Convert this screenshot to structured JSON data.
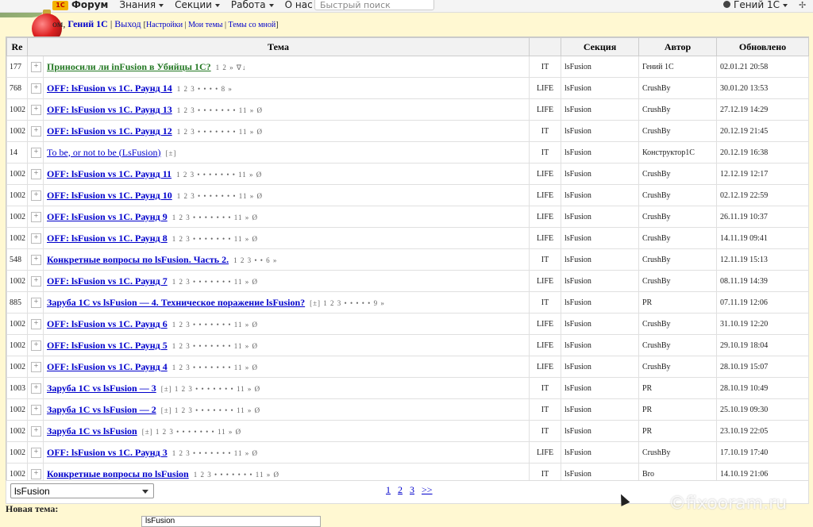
{
  "topbar": {
    "nav": [
      "Форум",
      "Знания",
      "Секции",
      "Работа",
      "О нас"
    ],
    "search_placeholder": "Быстрый поиск",
    "user": "Гений 1С"
  },
  "greeting": {
    "prefix": "ом,",
    "user": "Гений 1С",
    "logout": "Выход",
    "settings": "Настройки",
    "my_topics": "Мои темы",
    "topics_with_me": "Темы со мной"
  },
  "table": {
    "headers": {
      "replies": "Re",
      "title": "Тема",
      "section": "Секция",
      "author": "Автор",
      "updated": "Обновлено"
    },
    "rows": [
      {
        "re": "177",
        "title": "Приносили ли inFusion в Убийцы 1С?",
        "pages": "1 2 » ∇↓",
        "sec": "IT",
        "section": "lsFusion",
        "author": "Гений 1С",
        "updated": "02.01.21 20:58"
      },
      {
        "re": "768",
        "title": "OFF: lsFusion vs 1C. Раунд 14",
        "pages": "1 2 3 • • • • 8 »",
        "sec": "LIFE",
        "section": "lsFusion",
        "author": "CrushBy",
        "updated": "30.01.20 13:53"
      },
      {
        "re": "1002",
        "title": "OFF: lsFusion vs 1C. Раунд 13",
        "pages": "1 2 3 • • • • • • • 11 » Ø",
        "sec": "LIFE",
        "section": "lsFusion",
        "author": "CrushBy",
        "updated": "27.12.19 14:29"
      },
      {
        "re": "1002",
        "title": "OFF: lsFusion vs 1C. Раунд 12",
        "pages": "1 2 3 • • • • • • • 11 » Ø",
        "sec": "IT",
        "section": "lsFusion",
        "author": "CrushBy",
        "updated": "20.12.19 21:45"
      },
      {
        "re": "14",
        "title": "To be, or not to be (LsFusion)",
        "pages": "[±]",
        "sec": "IT",
        "section": "lsFusion",
        "author": "Конструктор1С",
        "updated": "20.12.19 16:38"
      },
      {
        "re": "1002",
        "title": "OFF: lsFusion vs 1C. Раунд 11",
        "pages": "1 2 3 • • • • • • • 11 » Ø",
        "sec": "LIFE",
        "section": "lsFusion",
        "author": "CrushBy",
        "updated": "12.12.19 12:17"
      },
      {
        "re": "1002",
        "title": "OFF: lsFusion vs 1C. Раунд 10",
        "pages": "1 2 3 • • • • • • • 11 » Ø",
        "sec": "LIFE",
        "section": "lsFusion",
        "author": "CrushBy",
        "updated": "02.12.19 22:59"
      },
      {
        "re": "1002",
        "title": "OFF: lsFusion vs 1C. Раунд 9",
        "pages": "1 2 3 • • • • • • • 11 » Ø",
        "sec": "LIFE",
        "section": "lsFusion",
        "author": "CrushBy",
        "updated": "26.11.19 10:37"
      },
      {
        "re": "1002",
        "title": "OFF: lsFusion vs 1C. Раунд 8",
        "pages": "1 2 3 • • • • • • • 11 » Ø",
        "sec": "LIFE",
        "section": "lsFusion",
        "author": "CrushBy",
        "updated": "14.11.19 09:41"
      },
      {
        "re": "548",
        "title": "Конкретные вопросы по lsFusion. Часть 2.",
        "pages": "1 2 3 • • 6 »",
        "sec": "IT",
        "section": "lsFusion",
        "author": "CrushBy",
        "updated": "12.11.19 15:13"
      },
      {
        "re": "1002",
        "title": "OFF: lsFusion vs 1C. Раунд 7",
        "pages": "1 2 3 • • • • • • • 11 » Ø",
        "sec": "LIFE",
        "section": "lsFusion",
        "author": "CrushBy",
        "updated": "08.11.19 14:39"
      },
      {
        "re": "885",
        "title": "Заруба 1С vs lsFusion — 4. Техническое поражение lsFusion?",
        "pages": "[±] 1 2 3 • • • • • 9 »",
        "sec": "IT",
        "section": "lsFusion",
        "author": "PR",
        "updated": "07.11.19 12:06"
      },
      {
        "re": "1002",
        "title": "OFF: lsFusion vs 1C. Раунд 6",
        "pages": "1 2 3 • • • • • • • 11 » Ø",
        "sec": "LIFE",
        "section": "lsFusion",
        "author": "CrushBy",
        "updated": "31.10.19 12:20"
      },
      {
        "re": "1002",
        "title": "OFF: lsFusion vs 1C. Раунд 5",
        "pages": "1 2 3 • • • • • • • 11 » Ø",
        "sec": "LIFE",
        "section": "lsFusion",
        "author": "CrushBy",
        "updated": "29.10.19 18:04"
      },
      {
        "re": "1002",
        "title": "OFF: lsFusion vs 1C. Раунд 4",
        "pages": "1 2 3 • • • • • • • 11 » Ø",
        "sec": "LIFE",
        "section": "lsFusion",
        "author": "CrushBy",
        "updated": "28.10.19 15:07"
      },
      {
        "re": "1003",
        "title": "Заруба 1С vs lsFusion — 3",
        "pages": "[±] 1 2 3 • • • • • • • 11 » Ø",
        "sec": "IT",
        "section": "lsFusion",
        "author": "PR",
        "updated": "28.10.19 10:49"
      },
      {
        "re": "1002",
        "title": "Заруба 1С vs lsFusion — 2",
        "pages": "[±] 1 2 3 • • • • • • • 11 » Ø",
        "sec": "IT",
        "section": "lsFusion",
        "author": "PR",
        "updated": "25.10.19 09:30"
      },
      {
        "re": "1002",
        "title": "Заруба 1С vs lsFusion",
        "pages": "[±] 1 2 3 • • • • • • • 11 » Ø",
        "sec": "IT",
        "section": "lsFusion",
        "author": "PR",
        "updated": "23.10.19 22:05"
      },
      {
        "re": "1002",
        "title": "OFF: lsFusion vs 1C. Раунд 3",
        "pages": "1 2 3 • • • • • • • 11 » Ø",
        "sec": "LIFE",
        "section": "lsFusion",
        "author": "CrushBy",
        "updated": "17.10.19 17:40"
      },
      {
        "re": "1002",
        "title": "Конкретные вопросы по lsFusion",
        "pages": "1 2 3 • • • • • • • 11 » Ø",
        "sec": "IT",
        "section": "lsFusion",
        "author": "Bro",
        "updated": "14.10.19 21:06"
      }
    ]
  },
  "bottom": {
    "select_value": "lsFusion",
    "pages": [
      "1",
      "2",
      "3",
      ">>"
    ],
    "new_topic_label": "Новая тема:",
    "new_topic_section": "lsFusion"
  },
  "watermark": "©fixooram.ru"
}
